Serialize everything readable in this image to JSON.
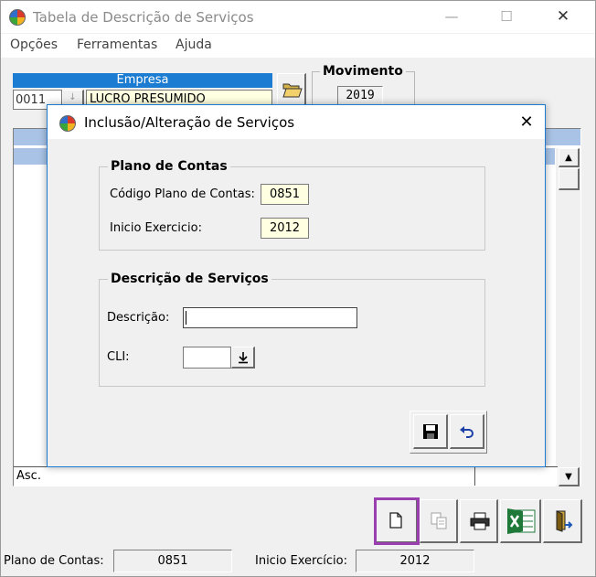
{
  "window": {
    "title": "Tabela de Descrição de Serviços",
    "minimize": "—",
    "maximize": "☐",
    "close": "✕"
  },
  "menu": [
    "Opções",
    "Ferramentas",
    "Ajuda"
  ],
  "empresa": {
    "header": "Empresa",
    "code": "0011",
    "name": "LUCRO PRESUMIDO"
  },
  "movimento": {
    "label": "Movimento",
    "year": "2019"
  },
  "grid": {
    "sort_label": "Asc."
  },
  "status": {
    "plano_label": "Plano de Contas:",
    "plano_value": "0851",
    "inicio_label": "Inicio Exercício:",
    "inicio_value": "2012"
  },
  "dialog": {
    "title": "Inclusão/Alteração de Serviços",
    "close": "✕",
    "plano_group": "Plano de Contas",
    "codigo_label": "Código Plano de Contas:",
    "codigo_value": "0851",
    "inicio_label": "Inicio Exercicio:",
    "inicio_value": "2012",
    "servicos_group": "Descrição de Serviços",
    "descricao_label": "Descrição:",
    "descricao_value": "",
    "cli_label": "CLI:",
    "cli_value": ""
  },
  "colors": {
    "accent_blue": "#1c7cd1",
    "grid_header": "#a9c3e6",
    "highlight_border": "#9b3fb0",
    "excel_green": "#1f7a3a"
  }
}
